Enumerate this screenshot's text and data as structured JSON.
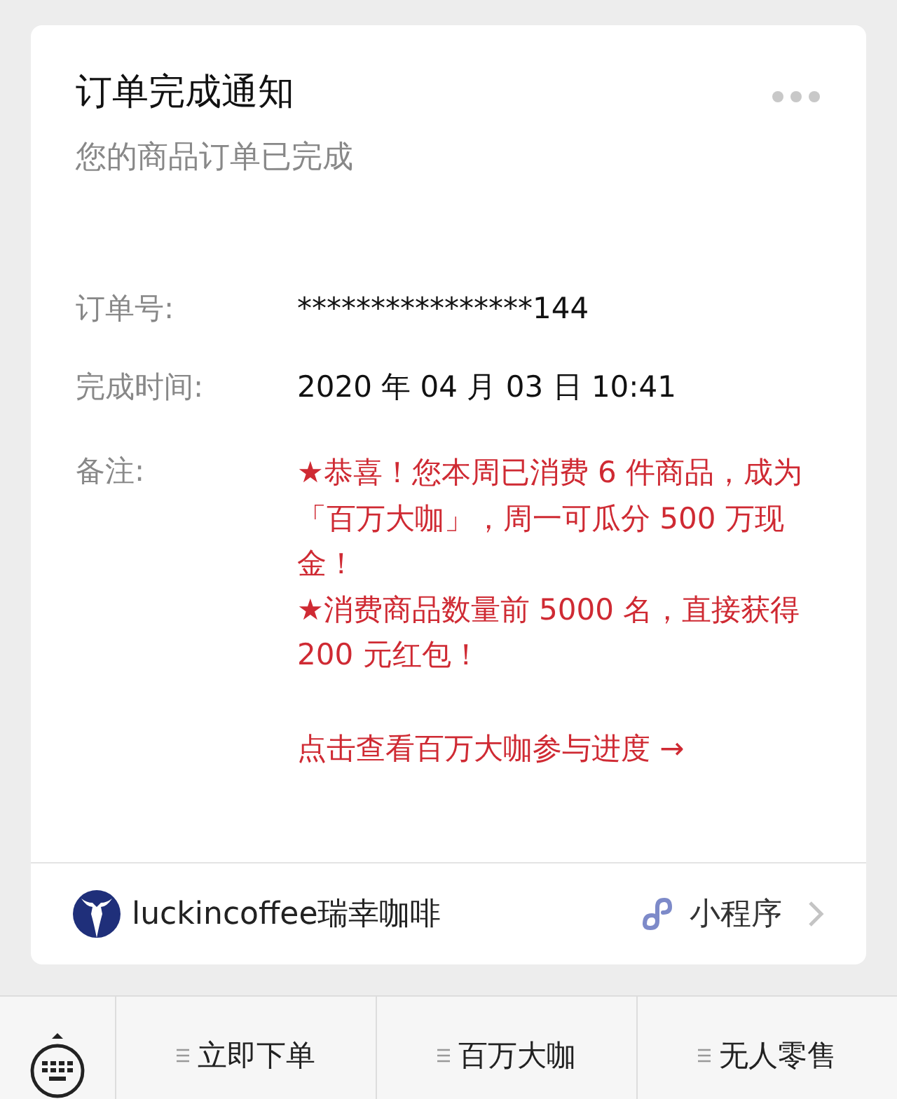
{
  "card": {
    "title": "订单完成通知",
    "subtitle": "您的商品订单已完成",
    "fields": [
      {
        "label": "订单号:",
        "value": "****************144"
      },
      {
        "label": "完成时间:",
        "value": "2020 年 04 月 03 日 10:41"
      }
    ],
    "note": {
      "label": "备注:",
      "paragraphs": [
        "★恭喜！您本周已消费 6 件商品，成为「百万大咖」，周一可瓜分 500 万现金！",
        "★消费商品数量前 5000 名，直接获得 200 元红包！"
      ],
      "link": "点击查看百万大咖参与进度 →"
    },
    "footer": {
      "brand": "luckincoffee瑞幸咖啡",
      "tag": "小程序"
    }
  },
  "menu_bar": {
    "items": [
      "立即下单",
      "百万大咖",
      "无人零售"
    ]
  }
}
